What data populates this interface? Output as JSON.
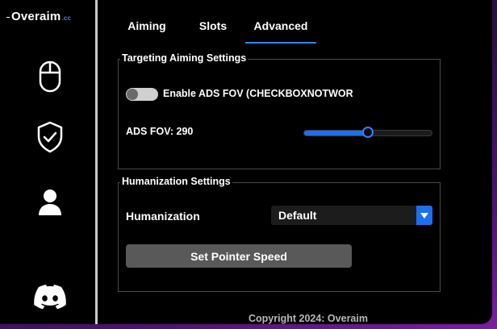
{
  "app": {
    "logo_name": "Overaim",
    "logo_suffix": ".cc"
  },
  "sidebar": {
    "items": [
      {
        "icon": "mouse-icon"
      },
      {
        "icon": "shield-check-icon"
      },
      {
        "icon": "user-icon"
      },
      {
        "icon": "discord-icon"
      }
    ]
  },
  "tabs": [
    {
      "label": "Aiming",
      "active": false
    },
    {
      "label": "Slots",
      "active": false
    },
    {
      "label": "Advanced",
      "active": true
    }
  ],
  "targeting": {
    "title": "Targeting Aiming Settings",
    "toggle_label": "Enable ADS FOV (CHECKBOXNOTWORKING)",
    "toggle_on": false,
    "fov_label": "ADS FOV: 290",
    "fov_level": 0.5
  },
  "humanization": {
    "title": "Humanization Settings",
    "label": "Humanization",
    "selected": "Default",
    "button_label": "Set Pointer Speed"
  },
  "footer": {
    "copyright": "Copyright 2024: Overaim"
  },
  "colors": {
    "accent": "#1e6ef0",
    "background": "#000000",
    "border": "#4a4a4a",
    "button": "#595959"
  }
}
